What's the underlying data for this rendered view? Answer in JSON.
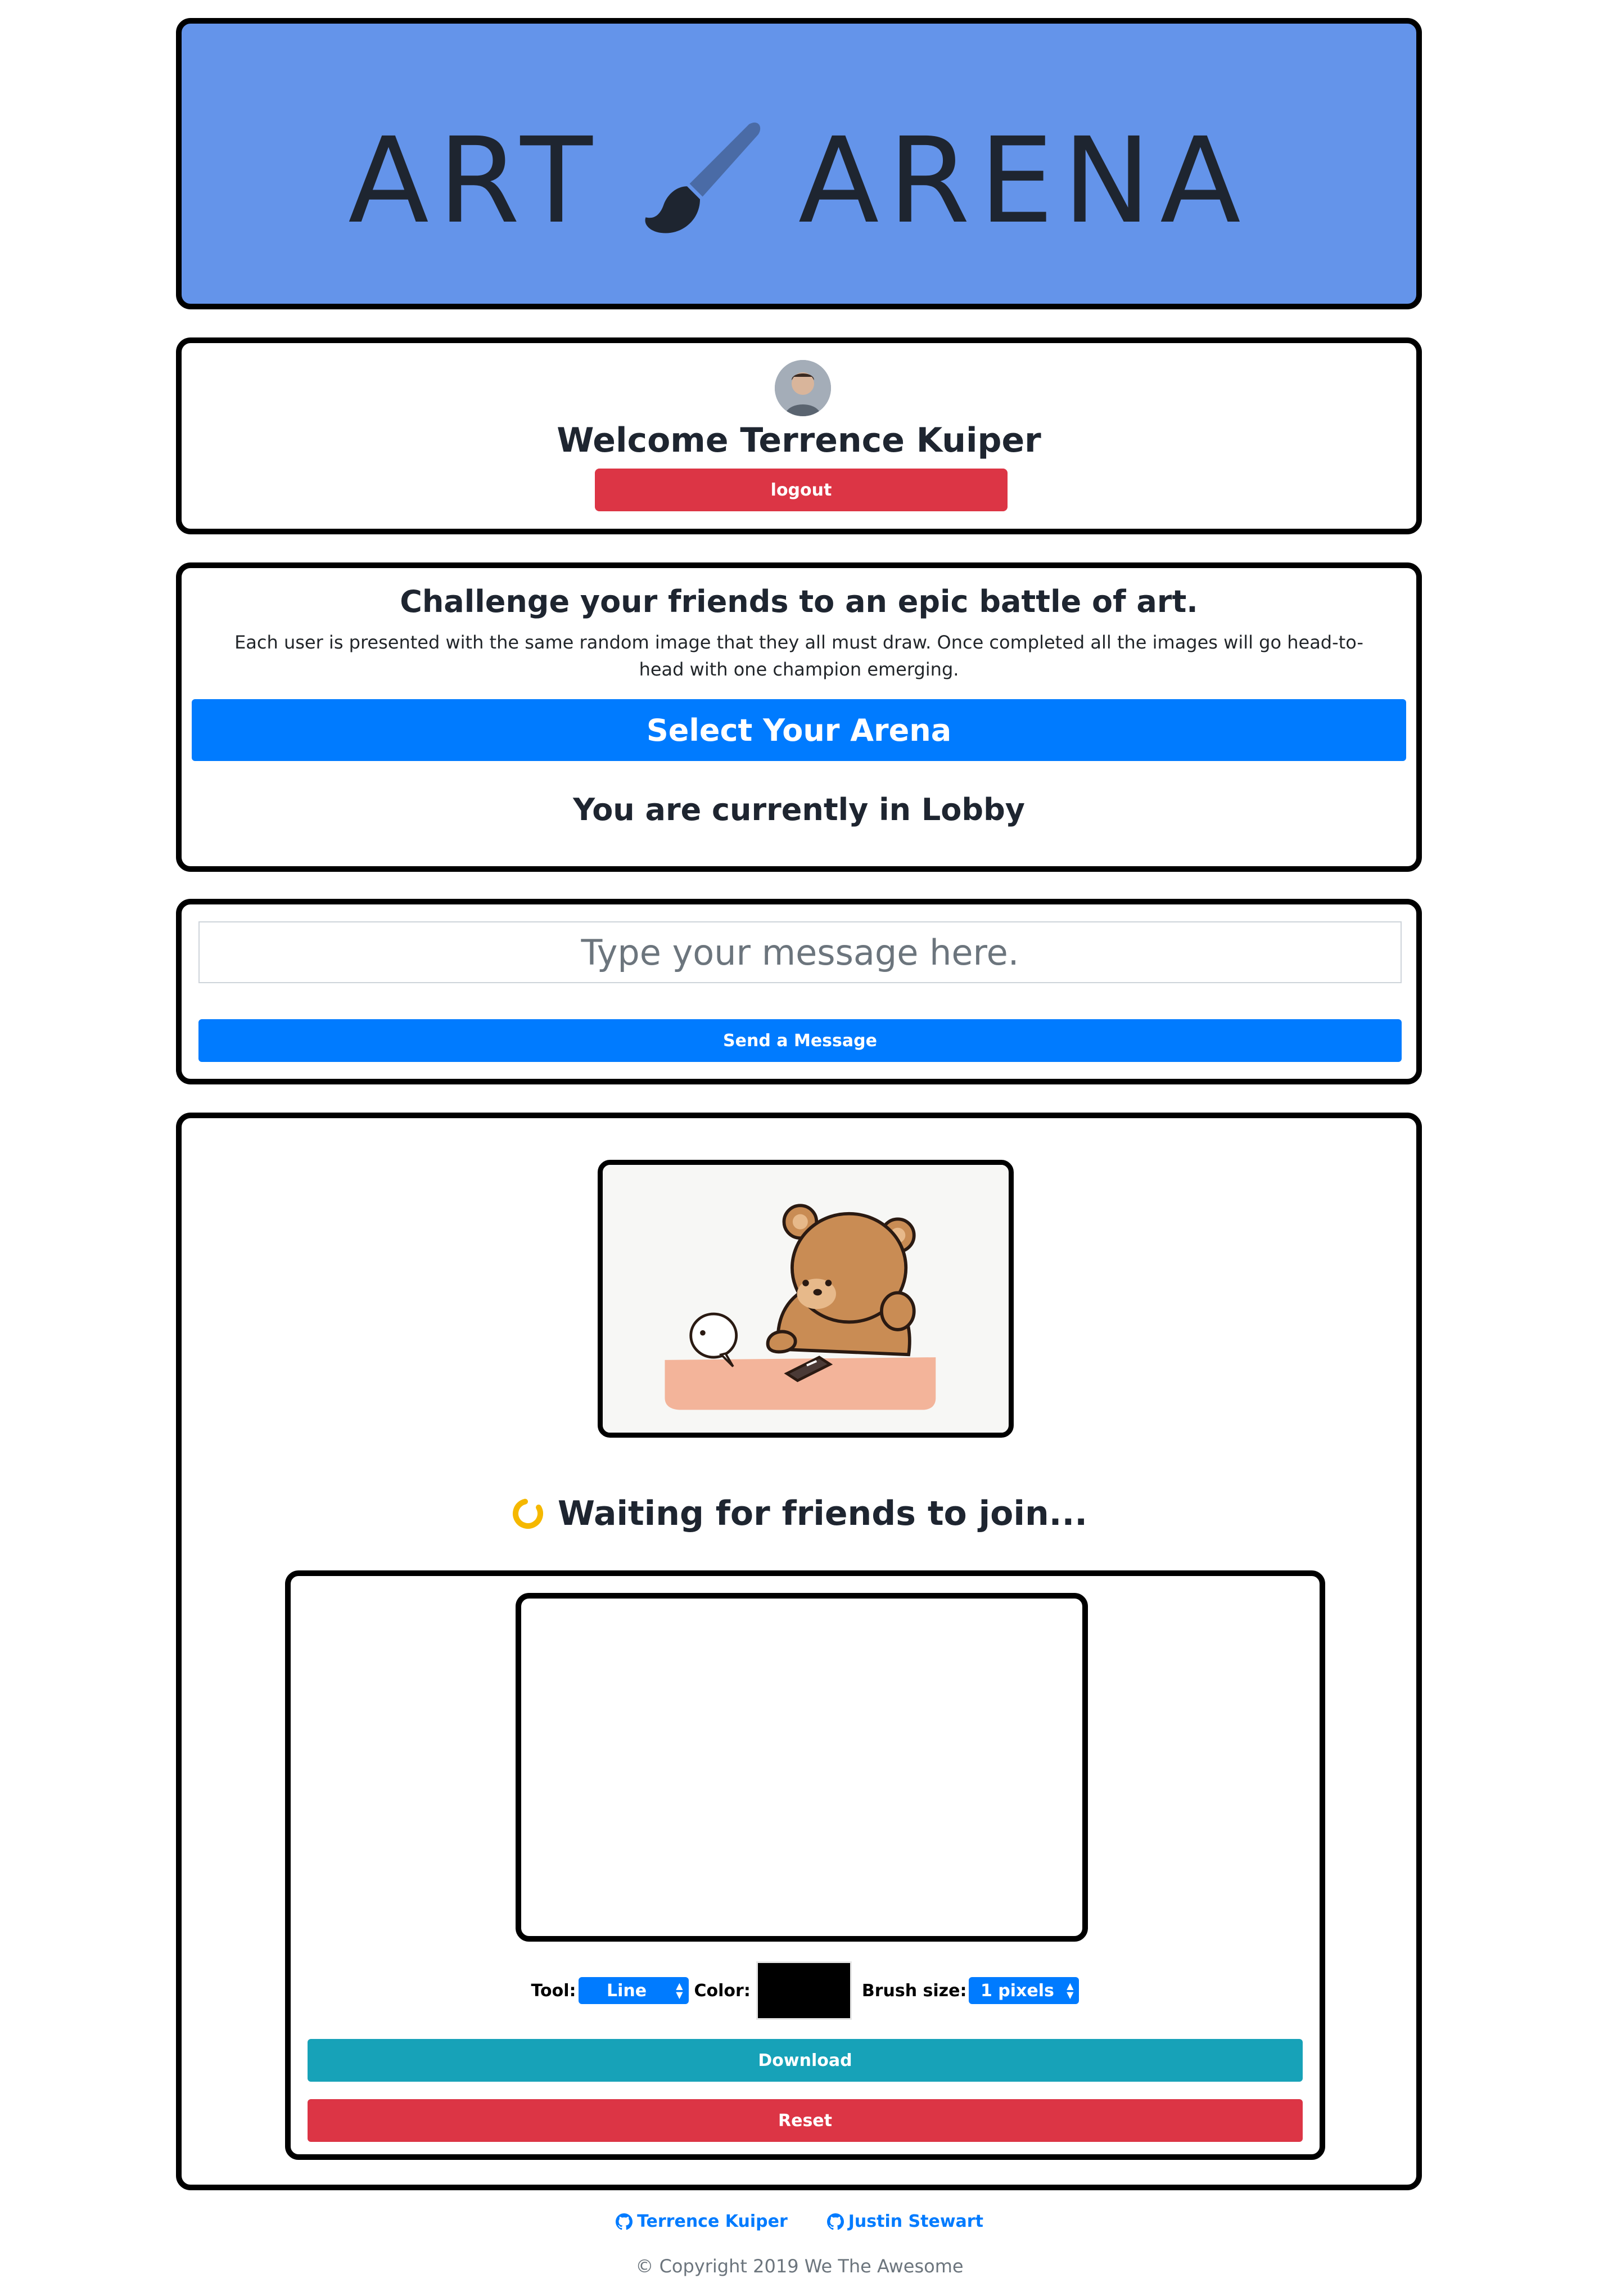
{
  "header": {
    "title_left": "ART",
    "title_right": "ARENA",
    "brush_icon": "paintbrush-icon",
    "bg_color": "#6494ea"
  },
  "welcome": {
    "avatar_icon": "user-avatar",
    "text": "Welcome Terrence Kuiper",
    "logout_label": "logout"
  },
  "challenge": {
    "title": "Challenge your friends to an epic battle of art.",
    "description": "Each user is presented with the same random image that they all must draw. Once completed all the images will go head-to-head with one champion emerging.",
    "arena_button": "Select Your Arena",
    "status": "You are currently in Lobby"
  },
  "message": {
    "placeholder": "Type your message here.",
    "send_label": "Send a Message"
  },
  "game": {
    "waiting_text": "Waiting for friends to join...",
    "tool_label": "Tool:",
    "tool_value": "Line",
    "color_label": "Color:",
    "color_value": "#000000",
    "brush_label": "Brush size:",
    "brush_value": "1 pixels",
    "download_label": "Download",
    "reset_label": "Reset"
  },
  "footer": {
    "links": [
      "Terrence Kuiper",
      "Justin Stewart"
    ],
    "copyright": "© Copyright 2019 We The Awesome"
  },
  "colors": {
    "primary": "#007bff",
    "danger": "#dc3545",
    "info": "#17a2b8",
    "spinner": "#f5b800"
  }
}
